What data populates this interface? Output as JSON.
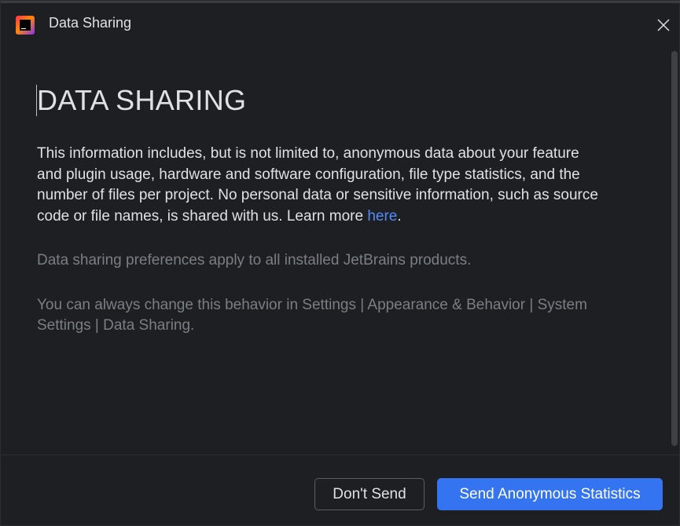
{
  "window": {
    "title": "Data Sharing"
  },
  "dialog": {
    "heading": "DATA SHARING",
    "body_text": "This information includes, but is not limited to, anonymous data about your feature and plugin usage, hardware and software configuration, file type statistics, and the number of files per project. No personal data or sensitive information, such as source code or file names, is shared with us. Learn more ",
    "link_text": "here",
    "link_trailing": ".",
    "note_preferences": "Data sharing preferences apply to all installed JetBrains products.",
    "note_settings": "You can always change this behavior in Settings | Appearance & Behavior | System Settings | Data Sharing."
  },
  "buttons": {
    "dont_send": "Don't Send",
    "send": "Send Anonymous Statistics"
  },
  "icons": {
    "app": "jetbrains-app-icon",
    "close": "close-icon"
  },
  "colors": {
    "background": "#1e1f22",
    "link": "#548af7",
    "primary": "#3574f0",
    "muted_text": "#7a7e85"
  }
}
